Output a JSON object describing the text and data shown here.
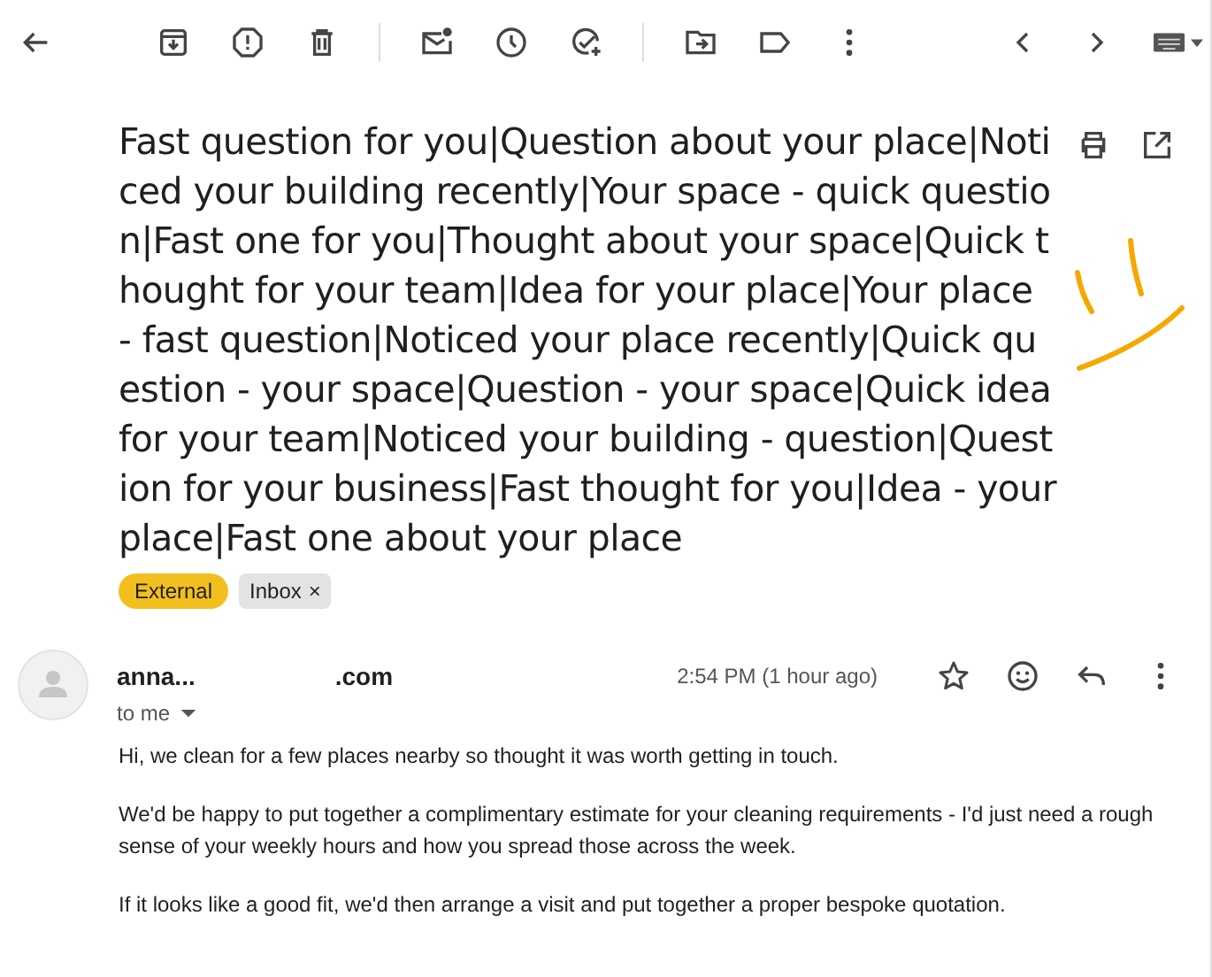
{
  "subject": "Fast question for you|Question about your place|Noticed your building recently|Your space - quick question|Fast one for you|Thought about your space|Quick thought for your team|Idea for your place|Your place - fast question|Noticed your place recently|Quick question - your space|Question - your space|Quick idea for your team|Noticed your building - question|Question for your business|Fast thought for you|Idea - your place|Fast one about your place",
  "labels": [
    {
      "text": "External",
      "kind": "tag",
      "color": "#f2c01e"
    },
    {
      "text": "Inbox",
      "kind": "removable",
      "color": "#e3e3e3"
    }
  ],
  "sender": {
    "name": "anna...",
    "domain": ".com",
    "recipient": "to me",
    "time": "2:54 PM (1 hour ago)"
  },
  "body": [
    "Hi, we clean for a few places nearby so thought it was worth getting in touch.",
    "We'd be happy to put together a complimentary estimate for your cleaning requirements - I'd just need a rough sense of your weekly hours and how you spread those across the week.",
    "If it looks like a good fit, we'd then arrange a visit and put together a proper bespoke quotation."
  ],
  "label_remove": "×"
}
